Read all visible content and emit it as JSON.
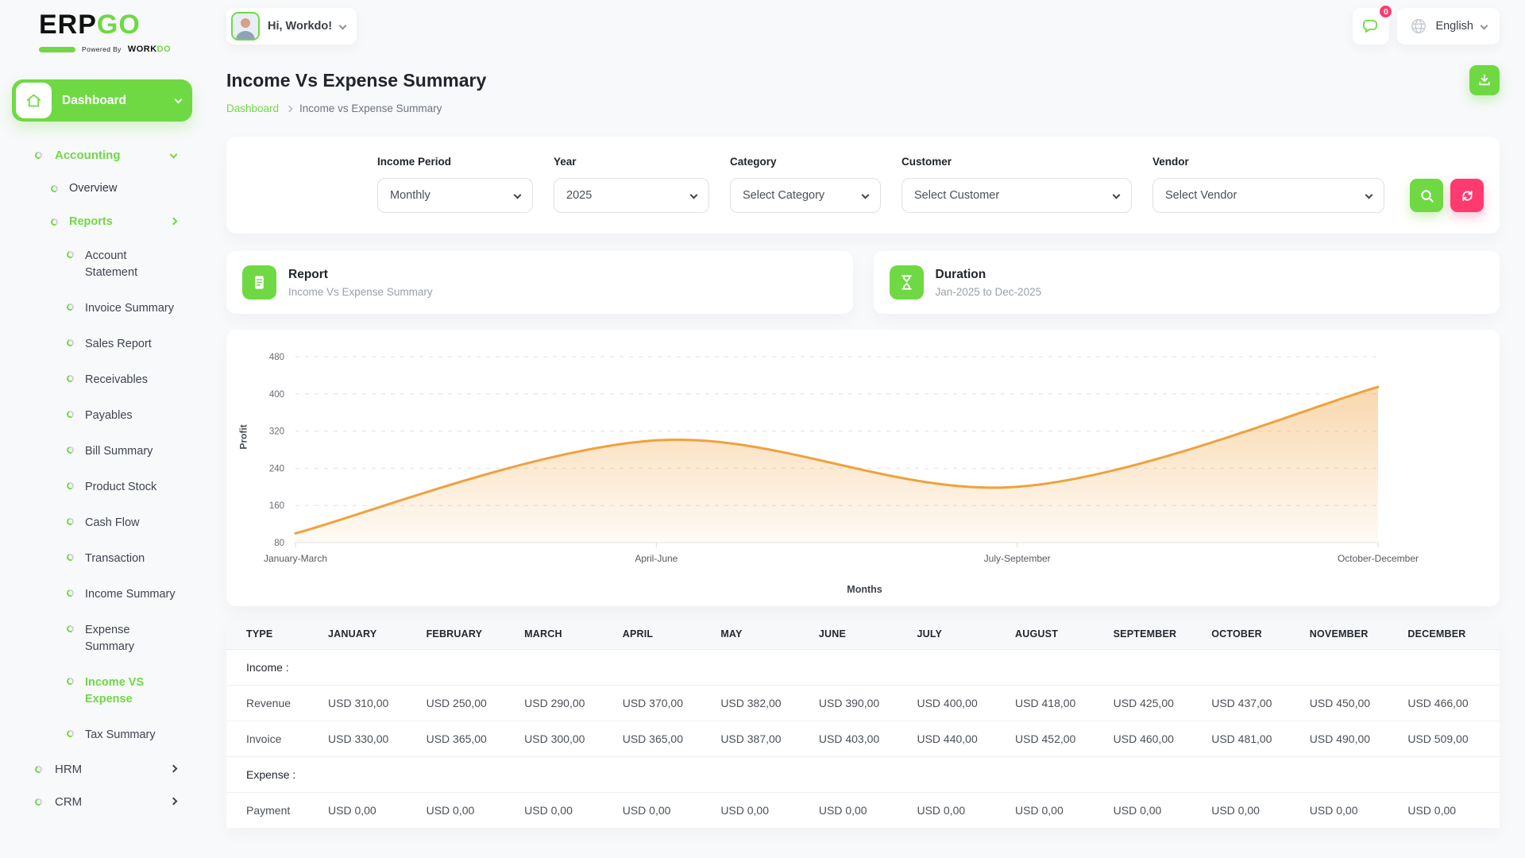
{
  "brand": {
    "logo_part1": "ERP",
    "logo_part2": "GO",
    "powered_by": "Powered By",
    "brand_sub1": "WORK",
    "brand_sub2": "DO"
  },
  "topbar": {
    "greeting": "Hi, Workdo!",
    "notification_count": "0",
    "language": "English"
  },
  "sidebar": {
    "dashboard": "Dashboard",
    "accounting": "Accounting",
    "overview": "Overview",
    "reports": "Reports",
    "report_items": [
      {
        "label": "Account Statement"
      },
      {
        "label": "Invoice Summary"
      },
      {
        "label": "Sales Report"
      },
      {
        "label": "Receivables"
      },
      {
        "label": "Payables"
      },
      {
        "label": "Bill Summary"
      },
      {
        "label": "Product Stock"
      },
      {
        "label": "Cash Flow"
      },
      {
        "label": "Transaction"
      },
      {
        "label": "Income Summary"
      },
      {
        "label": "Expense Summary"
      },
      {
        "label": "Income VS Expense",
        "active": true
      },
      {
        "label": "Tax Summary"
      }
    ],
    "hrm": "HRM",
    "crm": "CRM"
  },
  "page": {
    "title": "Income Vs Expense Summary",
    "breadcrumb_home": "Dashboard",
    "breadcrumb_current": "Income vs Expense Summary"
  },
  "filters": {
    "fields": [
      {
        "label": "Income Period",
        "value": "Monthly"
      },
      {
        "label": "Year",
        "value": "2025"
      },
      {
        "label": "Category",
        "value": "Select Category"
      },
      {
        "label": "Customer",
        "value": "Select Customer"
      },
      {
        "label": "Vendor",
        "value": "Select Vendor"
      }
    ]
  },
  "summary_cards": [
    {
      "title": "Report",
      "subtitle": "Income Vs Expense Summary"
    },
    {
      "title": "Duration",
      "subtitle": "Jan-2025 to Dec-2025"
    }
  ],
  "chart_data": {
    "type": "area",
    "categories": [
      "January-March",
      "April-June",
      "July-September",
      "October-December"
    ],
    "values": [
      100,
      300,
      200,
      415
    ],
    "title": "",
    "xlabel": "Months",
    "ylabel": "Profit",
    "yticks": [
      80,
      160,
      240,
      320,
      400,
      480
    ],
    "ylim": [
      80,
      480
    ],
    "grid": "dashed-horizontal",
    "legend": "none",
    "line_color": "#f0a13c"
  },
  "table": {
    "columns": [
      "TYPE",
      "JANUARY",
      "FEBRUARY",
      "MARCH",
      "APRIL",
      "MAY",
      "JUNE",
      "JULY",
      "AUGUST",
      "SEPTEMBER",
      "OCTOBER",
      "NOVEMBER",
      "DECEMBER"
    ],
    "rows": [
      {
        "label": "Income :",
        "section": true,
        "cells": []
      },
      {
        "label": "Revenue",
        "cells": [
          "USD 310,00",
          "USD 250,00",
          "USD 290,00",
          "USD 370,00",
          "USD 382,00",
          "USD 390,00",
          "USD 400,00",
          "USD 418,00",
          "USD 425,00",
          "USD 437,00",
          "USD 450,00",
          "USD 466,00"
        ]
      },
      {
        "label": "Invoice",
        "cells": [
          "USD 330,00",
          "USD 365,00",
          "USD 300,00",
          "USD 365,00",
          "USD 387,00",
          "USD 403,00",
          "USD 440,00",
          "USD 452,00",
          "USD 460,00",
          "USD 481,00",
          "USD 490,00",
          "USD 509,00"
        ]
      },
      {
        "label": "Expense :",
        "section": true,
        "cells": []
      },
      {
        "label": "Payment",
        "cells": [
          "USD 0,00",
          "USD 0,00",
          "USD 0,00",
          "USD 0,00",
          "USD 0,00",
          "USD 0,00",
          "USD 0,00",
          "USD 0,00",
          "USD 0,00",
          "USD 0,00",
          "USD 0,00",
          "USD 0,00"
        ]
      }
    ]
  },
  "colors": {
    "primary": "#6fd943",
    "danger": "#ff3a6e",
    "chart_line": "#f0a13c"
  }
}
